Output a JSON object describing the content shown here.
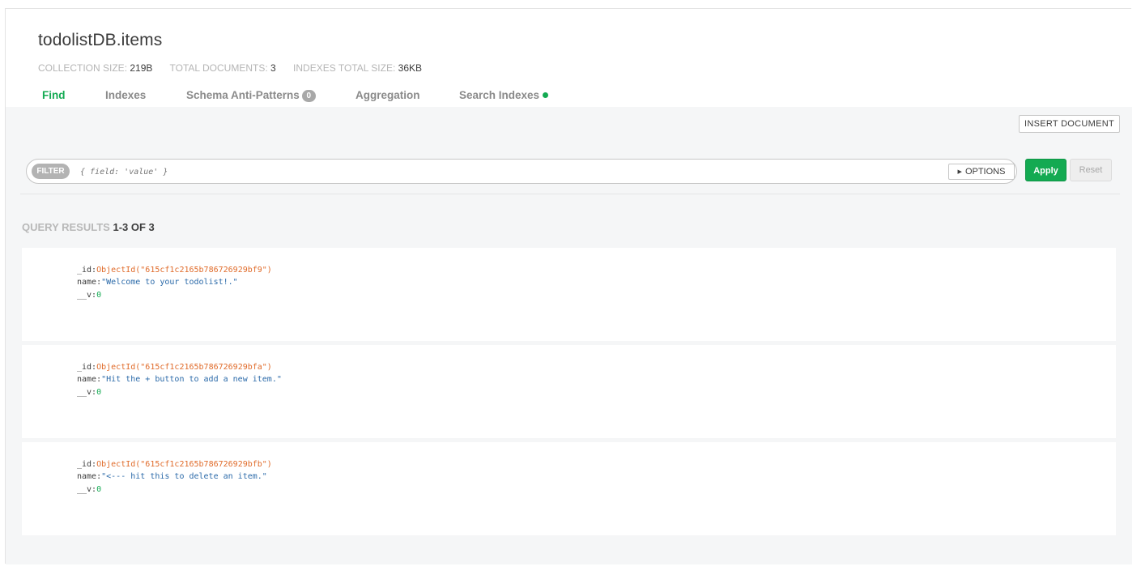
{
  "collection": {
    "title": "todolistDB.items",
    "stats": [
      {
        "label": "COLLECTION SIZE:",
        "value": "219B"
      },
      {
        "label": "TOTAL DOCUMENTS:",
        "value": "3"
      },
      {
        "label": "INDEXES TOTAL SIZE:",
        "value": "36KB"
      }
    ]
  },
  "tabs": [
    {
      "label": "Find",
      "active": true
    },
    {
      "label": "Indexes",
      "active": false
    },
    {
      "label": "Schema Anti-Patterns",
      "badge": "0",
      "active": false
    },
    {
      "label": "Aggregation",
      "active": false
    },
    {
      "label": "Search Indexes",
      "active": false
    }
  ],
  "toolbar": {
    "insert_label": "INSERT DOCUMENT"
  },
  "filter": {
    "tag": "FILTER",
    "placeholder": "{ field: 'value' }",
    "options_label": "OPTIONS",
    "apply_label": "Apply",
    "reset_label": "Reset"
  },
  "results": {
    "label": "QUERY RESULTS",
    "count": "1-3 OF 3"
  },
  "documents": [
    {
      "id_key": "_id:",
      "id_value": "ObjectId(\"615cf1c2165b786726929bf9\")",
      "name_key": "name:",
      "name_value": "\"Welcome to your todolist!.\"",
      "v_key": "__v:",
      "v_value": "0"
    },
    {
      "id_key": "_id:",
      "id_value": "ObjectId(\"615cf1c2165b786726929bfa\")",
      "name_key": "name:",
      "name_value": "\"Hit the + button to add a new item.\"",
      "v_key": "__v:",
      "v_value": "0"
    },
    {
      "id_key": "_id:",
      "id_value": "ObjectId(\"615cf1c2165b786726929bfb\")",
      "name_key": "name:",
      "name_value": "\"<--- hit this to delete an item.\"",
      "v_key": "__v:",
      "v_value": "0"
    }
  ],
  "colors": {
    "accent": "#13aa52",
    "object_id": "#e06b2a",
    "string_value": "#2b6aa9",
    "panel_bg": "#f5f6f7"
  }
}
